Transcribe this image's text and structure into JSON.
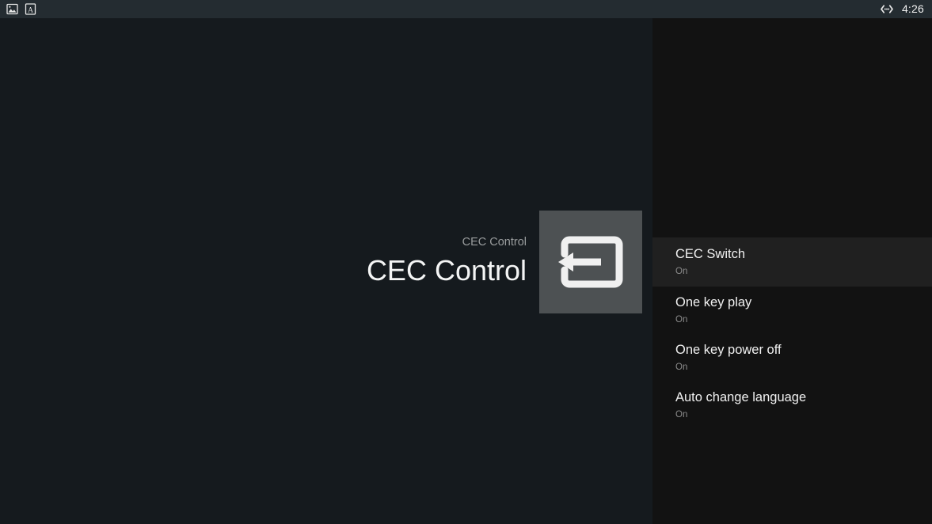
{
  "statusbar": {
    "left_icons": [
      {
        "name": "image-icon",
        "label": "image"
      },
      {
        "name": "font-icon",
        "label": "A"
      }
    ],
    "right_icons": [
      {
        "name": "ethernet-icon",
        "label": "ethernet"
      }
    ],
    "clock": "4:26"
  },
  "detail": {
    "breadcrumb": "CEC Control",
    "title": "CEC Control",
    "icon": "cec-exit-icon",
    "icon_tile_color": "#4d5153"
  },
  "settings_list": {
    "selected_index": 0,
    "items": [
      {
        "title": "CEC Switch",
        "value": "On"
      },
      {
        "title": "One key play",
        "value": "On"
      },
      {
        "title": "One key power off",
        "value": "On"
      },
      {
        "title": "Auto change language",
        "value": "On"
      }
    ]
  },
  "colors": {
    "status_bar": "#242c31",
    "left_pane": "#151a1e",
    "right_pane": "#121212",
    "row_selected": "#202020",
    "title_text": "#f4f5f5",
    "muted_text": "#8b8b8b"
  }
}
